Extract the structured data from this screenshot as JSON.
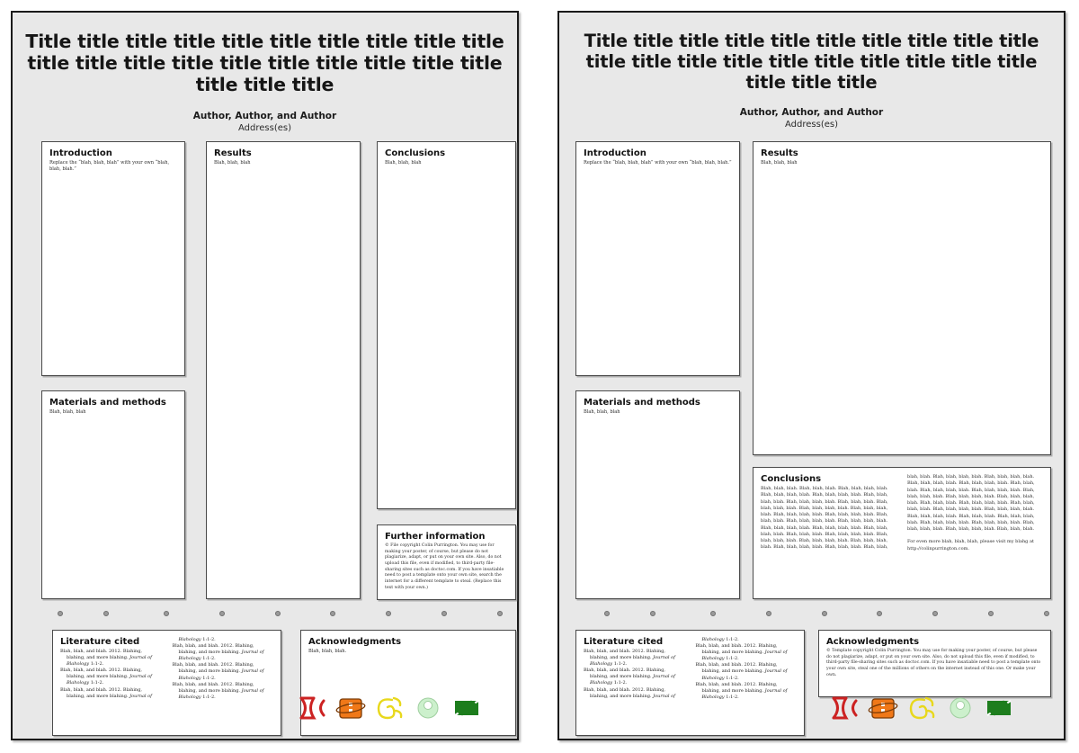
{
  "document": {
    "kind": "scientific-poster-template-preview",
    "variant_count": 2
  },
  "colors": {
    "poster_background": "#e8e8e8",
    "box_background": "#ffffff",
    "box_border": "#4a4a4a",
    "poster_border": "#1a1a1a",
    "dot_fill": "#9a9a9a",
    "logo_red": "#cc2222",
    "logo_orange": "#f07818",
    "logo_yellow": "#e8d81c",
    "logo_lightgreen": "#ccf0cc",
    "logo_darkgreen": "#1d7d1d"
  },
  "header": {
    "title": "Title title title title title title title title title title title title title title title title title title title title title title title",
    "authors": "Author, Author, and Author",
    "address": "Address(es)"
  },
  "sections": {
    "introduction": {
      "title": "Introduction",
      "body": "Replace the “blah, blah, blah” with your own “blah, blah, blah.”"
    },
    "materials": {
      "title": "Materials and methods",
      "body": "Blah, blah, blah"
    },
    "results": {
      "title": "Results",
      "body": "Blah, blah, blah"
    },
    "conclusions_short": {
      "title": "Conclusions",
      "body": "Blah, blah, blah"
    },
    "conclusions_long": {
      "title": "Conclusions",
      "body": "Blah, blah, blah. Blah, blah, blah. Blah, blah, blah, blah. Blah, blah, blah, blah. Blah, blah, blah, blah. Blah, blah, blah, blah. Blah, blah, blah, blah. Blah, blah, blah. Blah, blah, blah, blah. Blah, blah, blah, blah. Blah, blah, blah, blah. Blah, blah, blah, blah. Blah, blah, blah, blah. Blah, blah, blah. Blah, blah, blah, blah. Blah, blah, blah, blah. Blah, blah, blah, blah. Blah, blah, blah, blah. Blah, blah, blah, blah. Blah, blah, blah. Blah, blah, blah, blah. Blah, blah, blah, blah. Blah, blah, blah, blah. Blah, blah, blah, blah. Blah, blah, blah, blah. Blah, blah, blah. Blah, blah, blah, blah. Blah, blah, blah, blah. Blah, blah, blah, blah. Blah, blah, blah, blah. Blah, blah, blah, blah. Blah, blah, blah. Blah, blah, blah, blah. Blah, blah, blah, blah. Blah, blah, blah, blah. Blah, blah, blah, blah. Blah, blah, blah, blah. Blah, blah, blah. Blah, blah, blah, blah. Blah, blah, blah, blah. Blah, blah, blah, blah. Blah, blah, blah, blah. Blah, blah, blah, blah. Blah, blah, blah. Blah, blah, blah, blah. Blah, blah, blah, blah. Blah, blah, blah, blah. Blah, blah, blah, blah. Blah, blah, blah, blah. Blah, blah, blah.",
      "blog_note": "For even more blah, blah, blah, please visit my blahg at http://colinpurrington.com."
    },
    "further_information": {
      "title": "Further information",
      "body": "© File copyright Colin Purrington. You may use for making your poster, of course, but please do not plagiarize, adapt, or put on your own site. Also, do not upload this file, even if modified, to third-party file-sharing sites such as doctoc.com. If you have insatiable need to post a template onto your own site, search the internet for a different template to steal. (Replace this text with your own.)"
    },
    "literature_cited": {
      "title": "Literature cited",
      "references": [
        "Blah, blah, and blah.  2012.  Blahing, blahing, and more blahing.  Journal of Blahology 1:1-2.",
        "Blah, blah, and blah.  2012.  Blahing, blahing, and more blahing.  Journal of Blahology 1:1-2.",
        "Blah, blah, and blah.  2012.  Blahing, blahing, and more blahing.  Journal of Blahology 1:1-2.",
        "Blah, blah, and blah.  2012.  Blahing, blahing, and more blahing.  Journal of Blahology 1:1-2.",
        "Blah, blah, and blah.  2012.  Blahing, blahing, and more blahing.  Journal of Blahology 1:1-2.",
        "Blah, blah, and blah.  2012.  Blahing, blahing, and more blahing.  Journal of Blahology 1:1-2."
      ],
      "reference_journal": "Journal of Blahology",
      "reference_prefix": "Blah, blah, and blah.  2012.  Blahing, blahing, and more blahing.  ",
      "reference_suffix": " 1:1-2."
    },
    "acknowledgments_short": {
      "title": "Acknowledgments",
      "body": "Blah, blah, blah."
    },
    "acknowledgments_long": {
      "title": "Acknowledgments",
      "body": "© Template copyright Colin Purrington. You may use for making your poster, of course, but please do not plagiarize, adapt, or put on your own site. Also, do not upload this file, even if modified, to third-party file-sharing sites such as doctoc.com. If you have insatiable need to post a template onto your own site, steal one of the millions of others on the internet instead of this one. Or make your own."
    }
  },
  "logos": [
    {
      "name": "logo-red-hourglass",
      "color": "#cc2222"
    },
    {
      "name": "logo-orange-box",
      "color": "#f07818"
    },
    {
      "name": "logo-yellow-spiral",
      "color": "#e8d81c"
    },
    {
      "name": "logo-lightgreen-cell",
      "color": "#ccf0cc"
    },
    {
      "name": "logo-darkgreen-capsule",
      "color": "#1d7d1d"
    }
  ],
  "guide_dots": {
    "count": 9,
    "positions_pct": [
      9,
      18,
      30,
      41,
      52,
      63,
      74,
      85,
      96
    ]
  }
}
